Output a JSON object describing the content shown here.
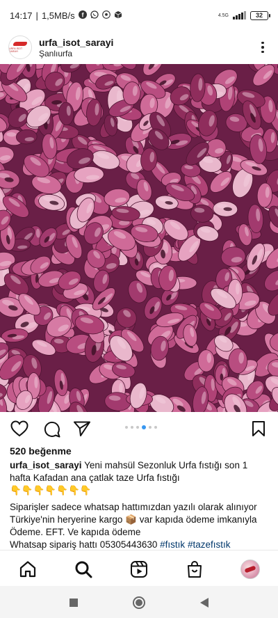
{
  "status_bar": {
    "time": "14:17",
    "net_speed": "1,5MB/s",
    "network_type": "4.5G",
    "battery": "32",
    "notification_icons": [
      "facebook-icon",
      "whatsapp-icon",
      "soccer-icon",
      "box-icon"
    ]
  },
  "post": {
    "username": "urfa_isot_sarayi",
    "location": "Şanlıurfa",
    "avatar_text": "URFA İSOT SARAYI",
    "image_subject": "purple pistachios",
    "carousel_pages": 6,
    "carousel_active_index": 3
  },
  "engagement": {
    "likes_text": "520 beğenme"
  },
  "caption": {
    "user": "urfa_isot_sarayi",
    "line1": "Yeni mahsül Sezonluk Urfa fıstığı son 1 hafta Kafadan ana  çatlak  taze Urfa fıstığı",
    "emoji_row": "👇👇👇👇👇👇👇",
    "line2": "Siparişler sadece whatsap hattımızdan yazılı olarak alınıyor Türkiye'nin heryerine kargo 📦 var kapıda ödeme imkanıyla Ödeme. EFT. Ve kapıda ödeme",
    "line3_prefix": "Whatsap sipariş hattı 05305443630",
    "tag1": "#fıstık",
    "tag2": "#tazefıstık"
  },
  "bottom_nav": [
    "home-icon",
    "search-icon",
    "reels-icon",
    "shop-icon",
    "profile-avatar"
  ],
  "colors": {
    "accent_blue": "#3897f0",
    "hashtag": "#00376b",
    "pistachio_dark": "#6a1f47",
    "pistachio_light": "#e6a2c0"
  }
}
